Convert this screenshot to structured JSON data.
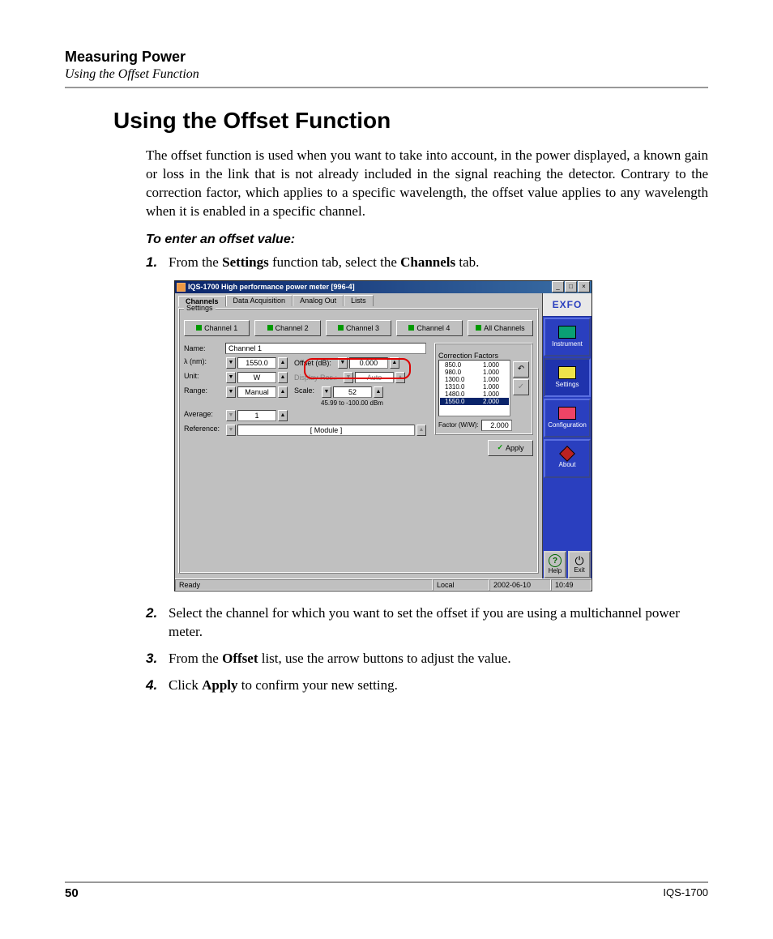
{
  "header": {
    "chapter": "Measuring Power",
    "subsection": "Using the Offset Function"
  },
  "section_title": "Using the Offset Function",
  "intro": "The offset function is used when you want to take into account, in the power displayed, a known gain or loss in the link that is not already included in the signal reaching the detector. Contrary to the correction factor, which applies to a specific wavelength, the offset value applies to any wavelength when it is enabled in a specific channel.",
  "task_title": "To enter an offset value:",
  "steps": {
    "s1_pre": "From the ",
    "s1_b1": "Settings",
    "s1_mid": " function tab, select the ",
    "s1_b2": "Channels",
    "s1_post": " tab.",
    "s2": "Select the channel for which you want to set the offset if you are using a multichannel power meter.",
    "s3_pre": "From the ",
    "s3_b1": "Offset",
    "s3_post": " list, use the arrow buttons to adjust the value.",
    "s4_pre": "Click ",
    "s4_b1": "Apply",
    "s4_post": " to confirm your new setting."
  },
  "footer": {
    "page": "50",
    "model": "IQS-1700"
  },
  "shot": {
    "title": "IQS-1700 High performance power meter [996-4]",
    "tabs": {
      "channels": "Channels",
      "data_acq": "Data Acquisition",
      "analog": "Analog Out",
      "lists": "Lists"
    },
    "settings_label": "Settings",
    "channels": {
      "c1": "Channel 1",
      "c2": "Channel 2",
      "c3": "Channel 3",
      "c4": "Channel 4",
      "all": "All Channels"
    },
    "labels": {
      "name": "Name:",
      "lambda": "λ  (nm):",
      "unit": "Unit:",
      "range": "Range:",
      "average": "Average:",
      "reference": "Reference:",
      "offset": "Offset (dB):",
      "display_res": "Display Res.:",
      "scale": "Scale:"
    },
    "values": {
      "name": "Channel 1",
      "lambda": "1550.0",
      "unit": "W",
      "range": "Manual",
      "average": "1",
      "reference": "[ Module ]",
      "offset": "0.000",
      "display_res": "Auto",
      "scale": "52",
      "range_note": "45.99 to -100.00 dBm"
    },
    "cf": {
      "title": "Correction Factors",
      "rows": [
        {
          "wl": "850.0",
          "f": "1.000"
        },
        {
          "wl": "980.0",
          "f": "1.000"
        },
        {
          "wl": "1300.0",
          "f": "1.000"
        },
        {
          "wl": "1310.0",
          "f": "1.000"
        },
        {
          "wl": "1480.0",
          "f": "1.000"
        },
        {
          "wl": "1550.0",
          "f": "2.000"
        }
      ],
      "factor_label": "Factor (W/W):",
      "factor_value": "2.000"
    },
    "apply": "Apply",
    "side": {
      "logo": "EXFO",
      "instrument": "Instrument",
      "settings": "Settings",
      "configuration": "Configuration",
      "about": "About",
      "help": "Help",
      "exit": "Exit"
    },
    "status": {
      "ready": "Ready",
      "local": "Local",
      "date": "2002-06-10",
      "time": "10:49"
    }
  }
}
